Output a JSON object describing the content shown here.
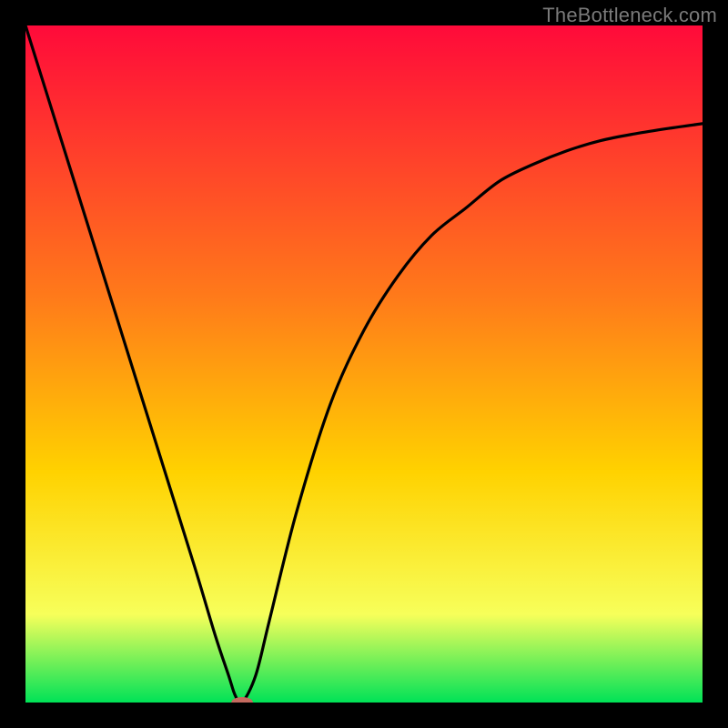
{
  "watermark": "TheBottleneck.com",
  "colors": {
    "top": "#ff0a3a",
    "mid_upper_orange": "#ff7a1a",
    "mid_yellow": "#ffd200",
    "lower_yellow": "#f7ff5a",
    "green": "#00e257",
    "marker": "#c46a5f",
    "curve": "#000000",
    "frame": "#000000"
  },
  "chart_data": {
    "type": "line",
    "title": "",
    "xlabel": "",
    "ylabel": "",
    "xlim": [
      0,
      100
    ],
    "ylim": [
      0,
      100
    ],
    "x": [
      0,
      5,
      10,
      15,
      20,
      25,
      28,
      30,
      31,
      32,
      34,
      36,
      40,
      45,
      50,
      55,
      60,
      65,
      70,
      75,
      80,
      85,
      90,
      95,
      100
    ],
    "values": [
      100,
      84,
      68,
      52,
      36,
      20,
      10,
      4,
      1,
      0,
      4,
      12,
      28,
      44,
      55,
      63,
      69,
      73,
      77,
      79.5,
      81.5,
      83,
      84,
      84.8,
      85.5
    ],
    "minimum": {
      "x": 32,
      "y": 0
    },
    "marker": {
      "x": 32,
      "y": 0,
      "rx": 1.6,
      "ry": 0.8
    }
  }
}
